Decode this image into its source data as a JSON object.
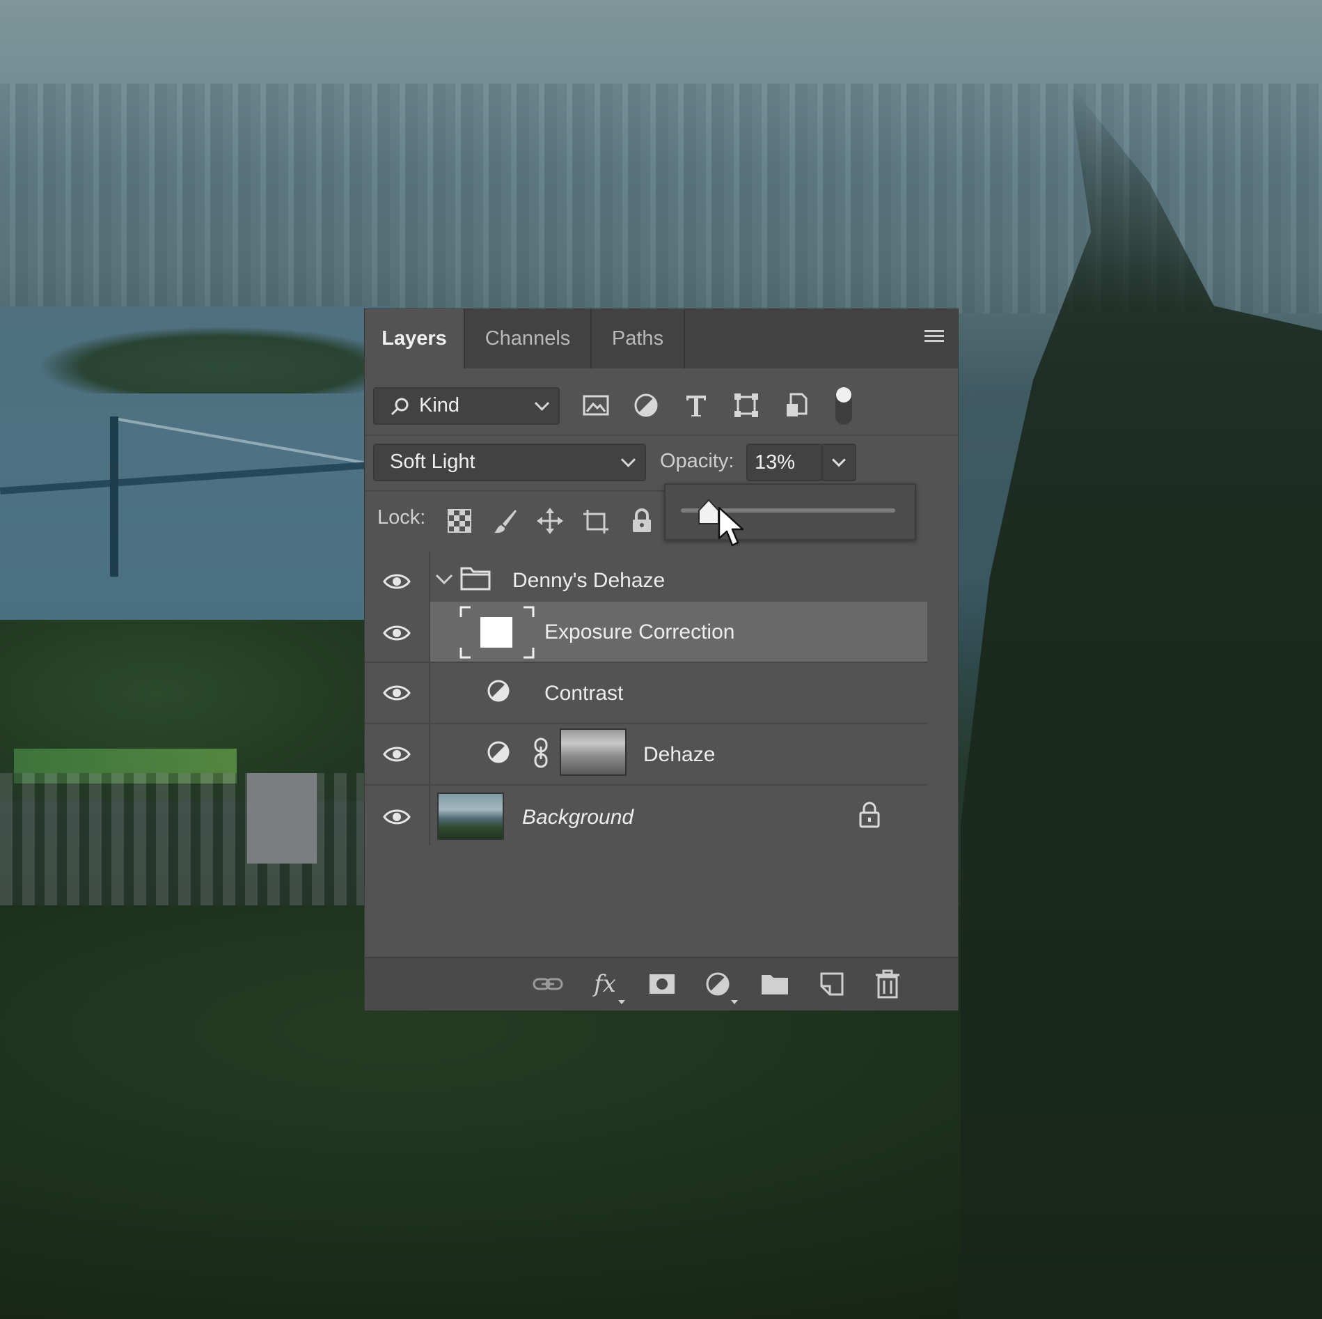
{
  "panel": {
    "tabs": [
      {
        "label": "Layers",
        "active": true
      },
      {
        "label": "Channels",
        "active": false
      },
      {
        "label": "Paths",
        "active": false
      }
    ],
    "menu_icon": "panel-menu-icon"
  },
  "filter": {
    "kind_label": "Kind",
    "filter_icons": [
      "pixel-layer-filter-icon",
      "adjustment-layer-filter-icon",
      "type-layer-filter-icon",
      "shape-layer-filter-icon",
      "smart-object-filter-icon"
    ],
    "filter_toggle_on": true
  },
  "blend": {
    "mode": "Soft Light",
    "opacity_label": "Opacity:",
    "opacity_value": "13%",
    "opacity_slider_fraction": 0.13
  },
  "lock": {
    "label": "Lock:",
    "icons": [
      "lock-transparent-pixels-icon",
      "lock-image-pixels-icon",
      "lock-position-icon",
      "lock-artboard-icon",
      "lock-all-icon"
    ]
  },
  "layers": [
    {
      "name": "Denny's Dehaze",
      "type": "group",
      "visible": true,
      "expanded": true
    },
    {
      "name": "Exposure Correction",
      "type": "layer",
      "visible": true,
      "selected": true
    },
    {
      "name": "Contrast",
      "type": "adjustment",
      "visible": true
    },
    {
      "name": "Dehaze",
      "type": "adjustment-with-mask",
      "visible": true
    },
    {
      "name": "Background",
      "type": "background",
      "visible": true,
      "locked": true
    }
  ],
  "bottom_bar": {
    "icons": [
      "link-layers-icon",
      "layer-style-fx-icon",
      "add-mask-icon",
      "new-adjustment-layer-icon",
      "new-group-icon",
      "new-layer-icon",
      "delete-layer-icon"
    ],
    "fx_label": "fx"
  },
  "colors": {
    "panel_bg": "#535353",
    "tab_bar_bg": "#424242",
    "selected_row": "#696969"
  }
}
